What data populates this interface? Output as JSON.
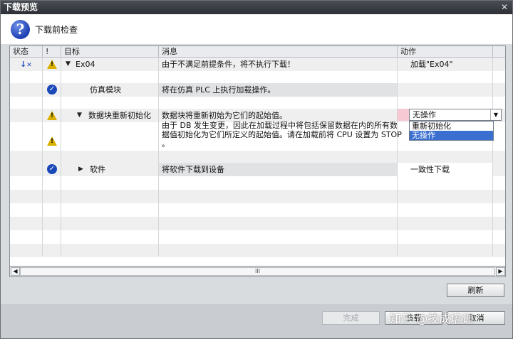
{
  "window": {
    "title": "下载预览",
    "close": "✕"
  },
  "header": {
    "title": "下载前检查"
  },
  "columns": {
    "status": "状态",
    "flag": "!",
    "target": "目标",
    "message": "消息",
    "action": "动作"
  },
  "rows": [
    {
      "target": "Ex04",
      "message": "由于不满足前提条件，将不执行下载！",
      "action": "加载\"Ex04\""
    },
    {
      "target": "仿真模块",
      "message": "将在仿真 PLC 上执行加载操作。",
      "action": ""
    },
    {
      "target": "数据块重新初始化",
      "message": "数据块将重新初始为它们的起始值。",
      "action": "无操作"
    },
    {
      "message_line1": "由于 DB 发生变更，因此在加载过程中将包括保留数据在内的所有数",
      "message_line2": "据值初始化为它们所定义的起始值。请在加载前将 CPU 设置为 STOP",
      "message_line3": "。"
    },
    {
      "target": "软件",
      "message": "将软件下载到设备",
      "action": "一致性下载"
    }
  ],
  "dropdown": {
    "options": [
      "重新初始化",
      "无操作"
    ],
    "selected": "无操作"
  },
  "scrollbar": {
    "left": "◀",
    "right": "▶",
    "grip": "III"
  },
  "buttons": {
    "refresh": "刷新",
    "finish": "完成",
    "load": "装载",
    "cancel": "取消"
  },
  "watermark": "知乎 @技成培训",
  "colors": {
    "warning": "#d8b000",
    "ok": "#1a48b8",
    "selection": "#3a6fd0"
  },
  "icons": {
    "help": "?",
    "ok": "✓",
    "warn": "!",
    "expanded": "▼",
    "collapsed": "▶"
  }
}
